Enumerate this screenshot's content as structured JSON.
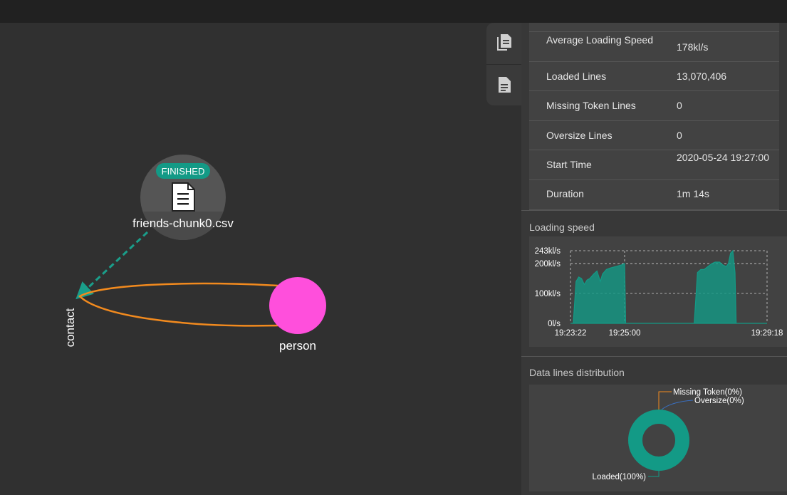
{
  "graph": {
    "file_node": {
      "status": "FINISHED",
      "name": "friends-chunk0.csv",
      "icon": "file-icon"
    },
    "vertex": {
      "label": "person",
      "color": "#ff4fdc"
    },
    "edge": {
      "label": "contact",
      "color": "#f28a1e"
    },
    "link_color": "#1a9e8a"
  },
  "side_tabs": [
    {
      "icon": "files-copy-icon"
    },
    {
      "icon": "document-icon"
    }
  ],
  "stats": {
    "rows": [
      {
        "key": "Average Loading Speed",
        "value": "178kl/s"
      },
      {
        "key": "Loaded Lines",
        "value": "13,070,406"
      },
      {
        "key": "Missing Token Lines",
        "value": "0"
      },
      {
        "key": "Oversize Lines",
        "value": "0"
      },
      {
        "key": "Start Time",
        "value": "2020-05-24 19:27:00"
      },
      {
        "key": "Duration",
        "value": "1m 14s"
      }
    ]
  },
  "loading_speed": {
    "title": "Loading speed"
  },
  "distribution": {
    "title": "Data lines distribution"
  },
  "chart_data": [
    {
      "type": "area",
      "title": "Loading speed",
      "color": "#139a86",
      "y_ticks": [
        "243kl/s",
        "200kl/s",
        "100kl/s",
        "0l/s"
      ],
      "y_tick_values": [
        243,
        200,
        100,
        0
      ],
      "x_ticks": [
        "19:23:22",
        "19:25:00",
        "19:29:18"
      ],
      "x_tick_values": [
        "19:23:22",
        "19:25:00",
        "19:29:18"
      ],
      "ylim": [
        0,
        243
      ],
      "xlim": [
        "19:23:22",
        "19:29:18"
      ],
      "grid": true,
      "series": [
        {
          "values": [
            {
              "x": "19:23:22",
              "y": 0
            },
            {
              "x": "19:23:27",
              "y": 0
            },
            {
              "x": "19:23:32",
              "y": 140
            },
            {
              "x": "19:23:37",
              "y": 155
            },
            {
              "x": "19:23:42",
              "y": 150
            },
            {
              "x": "19:23:47",
              "y": 130
            },
            {
              "x": "19:23:52",
              "y": 145
            },
            {
              "x": "19:23:57",
              "y": 150
            },
            {
              "x": "19:24:04",
              "y": 165
            },
            {
              "x": "19:24:10",
              "y": 175
            },
            {
              "x": "19:24:16",
              "y": 140
            },
            {
              "x": "19:24:20",
              "y": 165
            },
            {
              "x": "19:24:27",
              "y": 180
            },
            {
              "x": "19:24:34",
              "y": 185
            },
            {
              "x": "19:24:44",
              "y": 190
            },
            {
              "x": "19:24:54",
              "y": 195
            },
            {
              "x": "19:25:00",
              "y": 200
            },
            {
              "x": "19:25:02",
              "y": 0
            },
            {
              "x": "19:27:06",
              "y": 0
            },
            {
              "x": "19:27:12",
              "y": 170
            },
            {
              "x": "19:27:18",
              "y": 180
            },
            {
              "x": "19:27:24",
              "y": 180
            },
            {
              "x": "19:27:31",
              "y": 190
            },
            {
              "x": "19:27:38",
              "y": 200
            },
            {
              "x": "19:27:44",
              "y": 205
            },
            {
              "x": "19:27:52",
              "y": 205
            },
            {
              "x": "19:27:58",
              "y": 195
            },
            {
              "x": "19:28:04",
              "y": 190
            },
            {
              "x": "19:28:08",
              "y": 200
            },
            {
              "x": "19:28:12",
              "y": 235
            },
            {
              "x": "19:28:16",
              "y": 243
            },
            {
              "x": "19:28:20",
              "y": 170
            },
            {
              "x": "19:28:22",
              "y": 0
            },
            {
              "x": "19:29:18",
              "y": 0
            }
          ]
        }
      ]
    },
    {
      "type": "pie",
      "title": "Data lines distribution",
      "slices": [
        {
          "label": "Loaded(100%)",
          "value": 100,
          "color": "#139a86"
        },
        {
          "label": "Missing Token(0%)",
          "value": 0,
          "color": "#f28a1e"
        },
        {
          "label": "Oversize(0%)",
          "value": 0,
          "color": "#3a6fc0"
        }
      ]
    }
  ]
}
